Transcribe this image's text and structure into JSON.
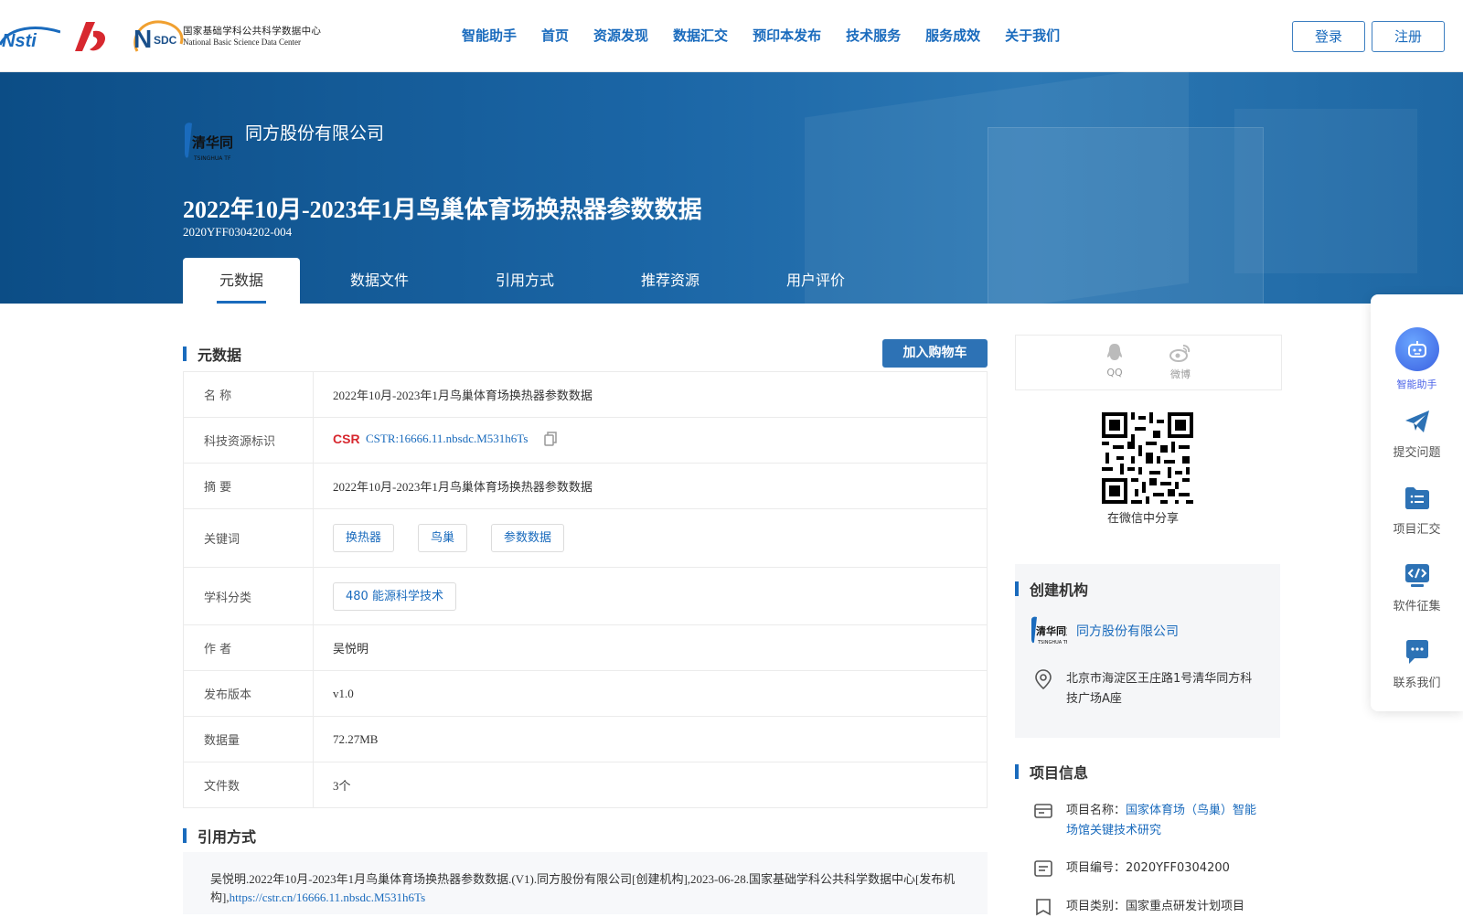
{
  "header": {
    "nsdc_cn": "国家基础学科公共科学数据中心",
    "nsdc_en": "National Basic Science Data Center",
    "nsdc_badge": "SDC",
    "nav": [
      "智能助手",
      "首页",
      "资源发现",
      "数据汇交",
      "预印本发布",
      "技术服务",
      "服务成效",
      "关于我们"
    ],
    "login": "登录",
    "register": "注册"
  },
  "hero": {
    "org_name": "同方股份有限公司",
    "title": "2022年10月-2023年1月鸟巢体育场换热器参数数据",
    "code": "2020YFF0304202-004",
    "tabs": [
      "元数据",
      "数据文件",
      "引用方式",
      "推荐资源",
      "用户评价"
    ]
  },
  "metadata": {
    "section_title": "元数据",
    "cart_button": "加入购物车",
    "rows": {
      "name": {
        "label": "名 称",
        "value": "2022年10月-2023年1月鸟巢体育场换热器参数数据"
      },
      "cstr": {
        "label": "科技资源标识",
        "value": "CSTR:16666.11.nbsdc.M531h6Ts"
      },
      "abstract": {
        "label": "摘 要",
        "value": "2022年10月-2023年1月鸟巢体育场换热器参数数据"
      },
      "keywords": {
        "label": "关键词",
        "values": [
          "换热器",
          "鸟巢",
          "参数数据"
        ]
      },
      "subject": {
        "label": "学科分类",
        "value": "480 能源科学技术"
      },
      "author": {
        "label": "作 者",
        "value": "吴悦明"
      },
      "version": {
        "label": "发布版本",
        "value": "v1.0"
      },
      "size": {
        "label": "数据量",
        "value": "72.27MB"
      },
      "files": {
        "label": "文件数",
        "value": "3个"
      }
    }
  },
  "citation": {
    "section_title": "引用方式",
    "text": "吴悦明.2022年10月-2023年1月鸟巢体育场换热器参数数据.(V1).同方股份有限公司[创建机构],2023-06-28.国家基础学科公共科学数据中心[发布机构],",
    "link": "https://cstr.cn/16666.11.nbsdc.M531h6Ts"
  },
  "share": {
    "qq": "QQ",
    "weibo": "微博",
    "wechat_label": "在微信中分享"
  },
  "creator": {
    "section_title": "创建机构",
    "name": "同方股份有限公司",
    "address": "北京市海淀区王庄路1号清华同方科技广场A座"
  },
  "project": {
    "section_title": "项目信息",
    "name_label": "项目名称：",
    "name_value": "国家体育场（鸟巢）智能场馆关键技术研究",
    "number": "项目编号：2020YFF0304200",
    "category": "项目类别：国家重点研发计划项目"
  },
  "floatbar": {
    "ai": "智能助手",
    "submit": "提交问题",
    "collect": "项目汇交",
    "software": "软件征集",
    "contact": "联系我们"
  },
  "colors": {
    "accent": "#1a6bbd",
    "hero": "#1b66a6",
    "cart": "#2d72b5"
  }
}
